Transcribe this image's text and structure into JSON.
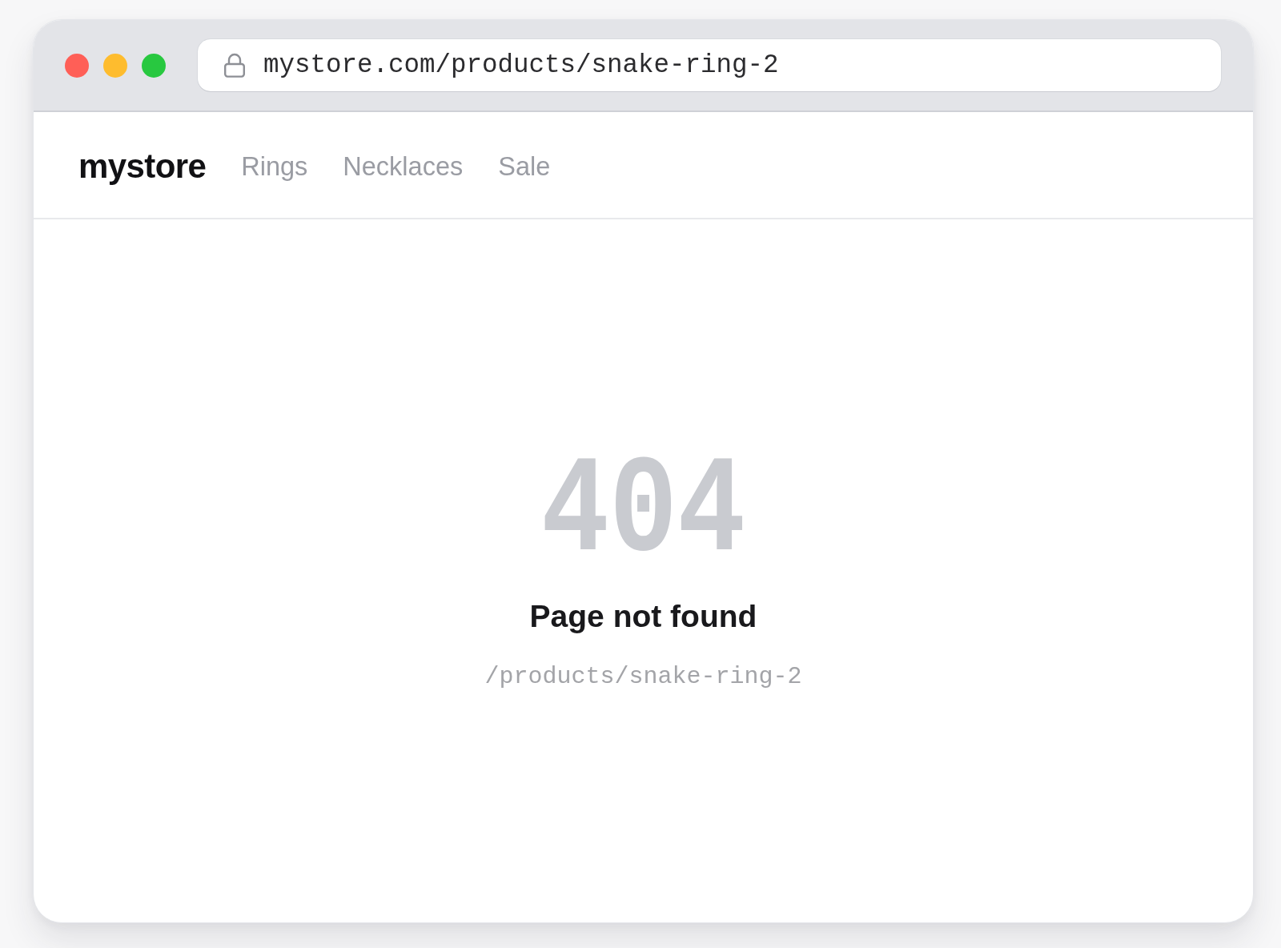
{
  "window_controls": [
    {
      "color": "#ff5f57"
    },
    {
      "color": "#febc2e"
    },
    {
      "color": "#28c840"
    }
  ],
  "address_bar": {
    "secure": true,
    "url": "mystore.com/products/snake-ring-2"
  },
  "nav": {
    "logo": "mystore",
    "links": [
      "Rings",
      "Necklaces",
      "Sale"
    ]
  },
  "error": {
    "code": "404",
    "title": "Page not found",
    "path": "/products/snake-ring-2"
  }
}
